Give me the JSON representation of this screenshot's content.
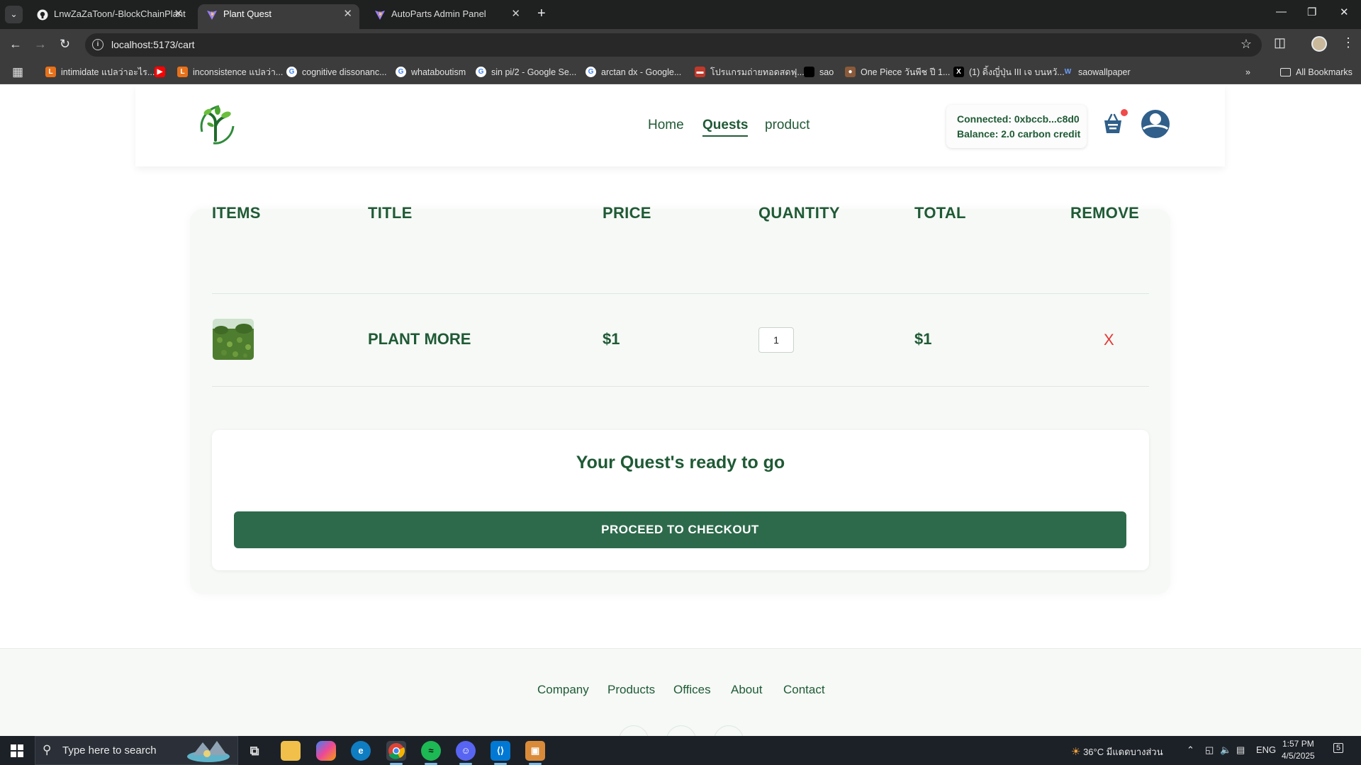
{
  "browser": {
    "tabs": [
      {
        "label": "LnwZaZaToon/-BlockChainPlant",
        "active": false
      },
      {
        "label": "Plant Quest",
        "active": true
      },
      {
        "label": "AutoParts Admin Panel",
        "active": false
      }
    ],
    "url": "localhost:5173/cart",
    "bookmarks": [
      "intimidate แปลว่าอะไร...",
      "",
      "inconsistence แปลว่า...",
      "cognitive dissonanc...",
      "whataboutism",
      "sin pi/2 - Google Se...",
      "arctan dx - Google...",
      "โปรแกรมถ่ายทอดสดฟุ...",
      "sao",
      "One Piece วันพีช ปี 1...",
      "(1) ดิ้งญี่ปุ่น III เจ บนหวั...",
      "saowallpaper"
    ],
    "all_bookmarks": "All Bookmarks"
  },
  "nav": {
    "links": [
      "Home",
      "Quests",
      "product"
    ],
    "active": "Quests"
  },
  "wallet": {
    "connected": "Connected: 0xbccb...c8d0",
    "balance": "Balance: 2.0 carbon credit"
  },
  "cart": {
    "columns": [
      "ITEMS",
      "TITLE",
      "PRICE",
      "QUANTITY",
      "TOTAL",
      "REMOVE"
    ],
    "rows": [
      {
        "title": "PLANT MORE",
        "price": "$1",
        "quantity": "1",
        "total": "$1",
        "remove": "X"
      }
    ],
    "summary_title": "Your Quest's ready to go",
    "checkout_label": "PROCEED TO CHECKOUT"
  },
  "footer": {
    "links": [
      "Company",
      "Products",
      "Offices",
      "About",
      "Contact"
    ]
  },
  "taskbar": {
    "search_placeholder": "Type here to search",
    "weather": "36°C มีแดดบางส่วน",
    "language": "ENG",
    "time": "1:57 PM",
    "date": "4/5/2025",
    "notifications": "5"
  },
  "colors": {
    "brand_green": "#1f5a35",
    "button_green": "#2d6a4b",
    "remove_red": "#e53935"
  }
}
